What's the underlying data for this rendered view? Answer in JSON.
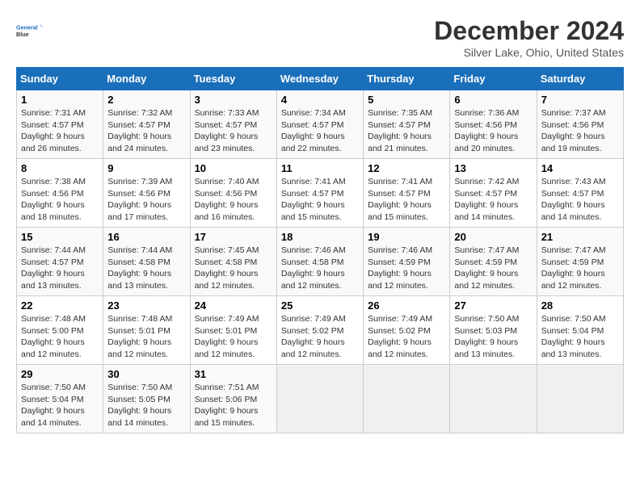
{
  "header": {
    "logo_line1": "General",
    "logo_line2": "Blue",
    "month": "December 2024",
    "location": "Silver Lake, Ohio, United States"
  },
  "days_of_week": [
    "Sunday",
    "Monday",
    "Tuesday",
    "Wednesday",
    "Thursday",
    "Friday",
    "Saturday"
  ],
  "weeks": [
    [
      {
        "day": "1",
        "sunrise": "7:31 AM",
        "sunset": "4:57 PM",
        "daylight_hours": "9",
        "daylight_minutes": "26"
      },
      {
        "day": "2",
        "sunrise": "7:32 AM",
        "sunset": "4:57 PM",
        "daylight_hours": "9",
        "daylight_minutes": "24"
      },
      {
        "day": "3",
        "sunrise": "7:33 AM",
        "sunset": "4:57 PM",
        "daylight_hours": "9",
        "daylight_minutes": "23"
      },
      {
        "day": "4",
        "sunrise": "7:34 AM",
        "sunset": "4:57 PM",
        "daylight_hours": "9",
        "daylight_minutes": "22"
      },
      {
        "day": "5",
        "sunrise": "7:35 AM",
        "sunset": "4:57 PM",
        "daylight_hours": "9",
        "daylight_minutes": "21"
      },
      {
        "day": "6",
        "sunrise": "7:36 AM",
        "sunset": "4:56 PM",
        "daylight_hours": "9",
        "daylight_minutes": "20"
      },
      {
        "day": "7",
        "sunrise": "7:37 AM",
        "sunset": "4:56 PM",
        "daylight_hours": "9",
        "daylight_minutes": "19"
      }
    ],
    [
      {
        "day": "8",
        "sunrise": "7:38 AM",
        "sunset": "4:56 PM",
        "daylight_hours": "9",
        "daylight_minutes": "18"
      },
      {
        "day": "9",
        "sunrise": "7:39 AM",
        "sunset": "4:56 PM",
        "daylight_hours": "9",
        "daylight_minutes": "17"
      },
      {
        "day": "10",
        "sunrise": "7:40 AM",
        "sunset": "4:56 PM",
        "daylight_hours": "9",
        "daylight_minutes": "16"
      },
      {
        "day": "11",
        "sunrise": "7:41 AM",
        "sunset": "4:57 PM",
        "daylight_hours": "9",
        "daylight_minutes": "15"
      },
      {
        "day": "12",
        "sunrise": "7:41 AM",
        "sunset": "4:57 PM",
        "daylight_hours": "9",
        "daylight_minutes": "15"
      },
      {
        "day": "13",
        "sunrise": "7:42 AM",
        "sunset": "4:57 PM",
        "daylight_hours": "9",
        "daylight_minutes": "14"
      },
      {
        "day": "14",
        "sunrise": "7:43 AM",
        "sunset": "4:57 PM",
        "daylight_hours": "9",
        "daylight_minutes": "14"
      }
    ],
    [
      {
        "day": "15",
        "sunrise": "7:44 AM",
        "sunset": "4:57 PM",
        "daylight_hours": "9",
        "daylight_minutes": "13"
      },
      {
        "day": "16",
        "sunrise": "7:44 AM",
        "sunset": "4:58 PM",
        "daylight_hours": "9",
        "daylight_minutes": "13"
      },
      {
        "day": "17",
        "sunrise": "7:45 AM",
        "sunset": "4:58 PM",
        "daylight_hours": "9",
        "daylight_minutes": "12"
      },
      {
        "day": "18",
        "sunrise": "7:46 AM",
        "sunset": "4:58 PM",
        "daylight_hours": "9",
        "daylight_minutes": "12"
      },
      {
        "day": "19",
        "sunrise": "7:46 AM",
        "sunset": "4:59 PM",
        "daylight_hours": "9",
        "daylight_minutes": "12"
      },
      {
        "day": "20",
        "sunrise": "7:47 AM",
        "sunset": "4:59 PM",
        "daylight_hours": "9",
        "daylight_minutes": "12"
      },
      {
        "day": "21",
        "sunrise": "7:47 AM",
        "sunset": "4:59 PM",
        "daylight_hours": "9",
        "daylight_minutes": "12"
      }
    ],
    [
      {
        "day": "22",
        "sunrise": "7:48 AM",
        "sunset": "5:00 PM",
        "daylight_hours": "9",
        "daylight_minutes": "12"
      },
      {
        "day": "23",
        "sunrise": "7:48 AM",
        "sunset": "5:01 PM",
        "daylight_hours": "9",
        "daylight_minutes": "12"
      },
      {
        "day": "24",
        "sunrise": "7:49 AM",
        "sunset": "5:01 PM",
        "daylight_hours": "9",
        "daylight_minutes": "12"
      },
      {
        "day": "25",
        "sunrise": "7:49 AM",
        "sunset": "5:02 PM",
        "daylight_hours": "9",
        "daylight_minutes": "12"
      },
      {
        "day": "26",
        "sunrise": "7:49 AM",
        "sunset": "5:02 PM",
        "daylight_hours": "9",
        "daylight_minutes": "12"
      },
      {
        "day": "27",
        "sunrise": "7:50 AM",
        "sunset": "5:03 PM",
        "daylight_hours": "9",
        "daylight_minutes": "13"
      },
      {
        "day": "28",
        "sunrise": "7:50 AM",
        "sunset": "5:04 PM",
        "daylight_hours": "9",
        "daylight_minutes": "13"
      }
    ],
    [
      {
        "day": "29",
        "sunrise": "7:50 AM",
        "sunset": "5:04 PM",
        "daylight_hours": "9",
        "daylight_minutes": "14"
      },
      {
        "day": "30",
        "sunrise": "7:50 AM",
        "sunset": "5:05 PM",
        "daylight_hours": "9",
        "daylight_minutes": "14"
      },
      {
        "day": "31",
        "sunrise": "7:51 AM",
        "sunset": "5:06 PM",
        "daylight_hours": "9",
        "daylight_minutes": "15"
      },
      null,
      null,
      null,
      null
    ]
  ]
}
